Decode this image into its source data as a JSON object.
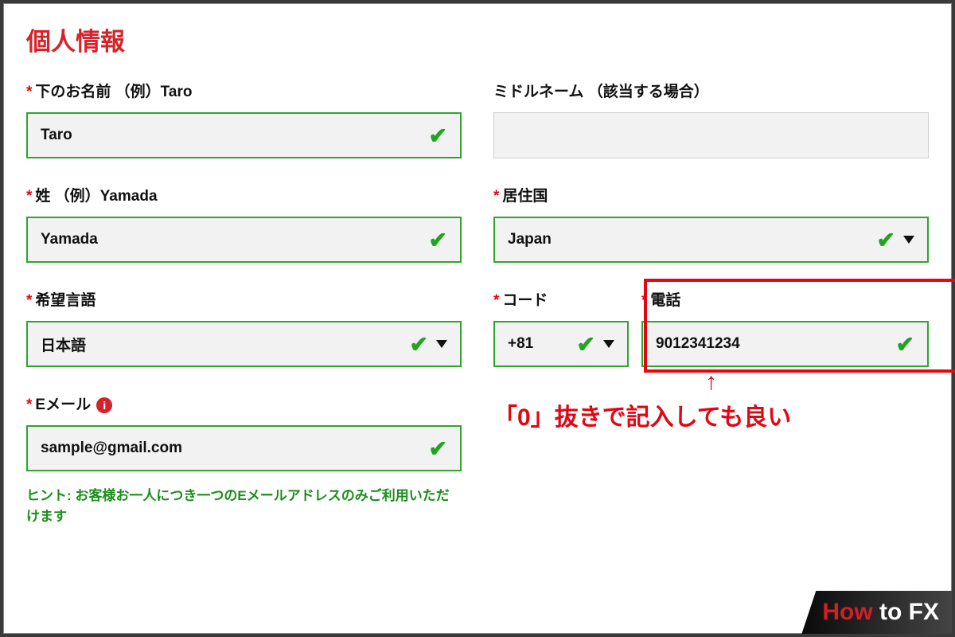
{
  "section_title": "個人情報",
  "left": {
    "first_name": {
      "label": "下のお名前 （例）Taro",
      "value": "Taro"
    },
    "last_name": {
      "label": "姓 （例）Yamada",
      "value": "Yamada"
    },
    "language": {
      "label": "希望言語",
      "value": "日本語"
    },
    "email": {
      "label": "Eメール",
      "value": "sample@gmail.com"
    },
    "hint": "ヒント: お客様お一人につき一つのEメールアドレスのみご利用いただけます"
  },
  "right": {
    "middle_name": {
      "label": "ミドルネーム （該当する場合）",
      "value": ""
    },
    "country": {
      "label": "居住国",
      "value": "Japan"
    },
    "code": {
      "label": "コード",
      "value": "+81"
    },
    "phone": {
      "label": "電話",
      "value": "9012341234"
    }
  },
  "callout": {
    "arrow": "↑",
    "text": "「0」抜きで記入しても良い"
  },
  "logo": {
    "how": "How",
    "to": " to ",
    "fx": "FX"
  },
  "icons": {
    "info": "i"
  }
}
